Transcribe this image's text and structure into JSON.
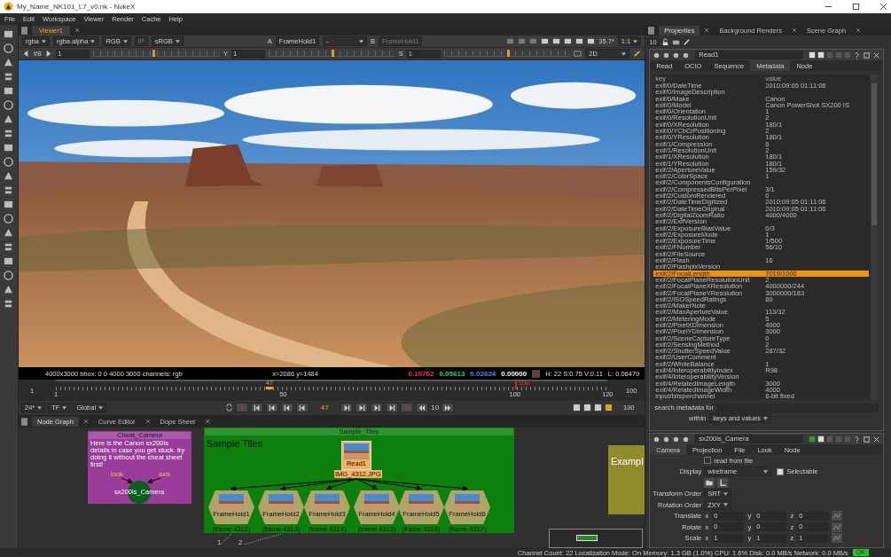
{
  "window": {
    "title": "My_Name_NK101_L7_v0.nk - NukeX"
  },
  "menu": [
    "File",
    "Edit",
    "Workspace",
    "Viewer",
    "Render",
    "Cache",
    "Help"
  ],
  "viewer": {
    "tab": "Viewer1",
    "toolbar1": {
      "channels": "rgba",
      "alpha": "rgba.alpha",
      "display": "RGB",
      "ip": "IP",
      "lut": "sRGB",
      "a_label": "A",
      "a_input": "FrameHold1",
      "op": "-",
      "b_label": "B",
      "b_input": "FrameHold1",
      "zoom": "35.7*",
      "ratio": "1:1"
    },
    "toolbar2": {
      "fstop": "f/8",
      "gain": "1",
      "gain_slider": {
        "level": 0.47
      },
      "gamma_label": "Y",
      "gamma": "1",
      "gamma_slider": {
        "level": 0.5
      },
      "sat_label": "S",
      "sat": "1",
      "sat_slider": {
        "level": 0.5
      },
      "mode": "2D"
    },
    "info": {
      "format": "4000x3000  bbox: 0 0 4000 3000 channels: rgb",
      "coords": "x=2086 y=1484",
      "samples": [
        {
          "value": "0.10702",
          "color": "#ff3030"
        },
        {
          "value": "0.05613",
          "color": "#30d060"
        },
        {
          "value": "0.02624",
          "color": "#4a8cff"
        },
        {
          "value": "0.00000",
          "color": "#ffffff"
        }
      ],
      "swatch": {
        "color": "#5e4632"
      },
      "hsv": "H: 22 S:0.75 V:0.11",
      "luma": "L: 0.06479"
    }
  },
  "timeline": {
    "start": "1",
    "end": "100",
    "current": "47",
    "playhead": {
      "level": 0.387
    },
    "out_mark": "100",
    "out_point": {
      "level": 0.832
    },
    "ticks": [
      {
        "label": "1",
        "level": 0
      },
      {
        "label": "50",
        "level": 0.412
      },
      {
        "label": "100",
        "level": 0.832
      },
      {
        "label": "120",
        "level": 1
      }
    ]
  },
  "playback": {
    "fps": "24*",
    "tf": "TF",
    "scope": "Global",
    "in": "I",
    "frame": "47",
    "out": "O",
    "step": "10",
    "last": "100"
  },
  "node_graph": {
    "tabs": [
      {
        "label": "Node Graph",
        "selected": true
      },
      {
        "label": "Curve Editor",
        "selected": false
      },
      {
        "label": "Dope Sheet",
        "selected": false
      }
    ],
    "backdrops": [
      {
        "title": "Cheat_Camera",
        "color": "#9a3c9a",
        "note": "Here is the Canon sx200is details in case you get stuck. try doing it without the cheat sheet first!"
      },
      {
        "title": "Sample_Tiles",
        "color": "#0d7f0d",
        "note": "Sample Tiles"
      },
      {
        "title": "Exampl",
        "color": "#8e8b2c"
      }
    ],
    "read_node": {
      "name": "Read1",
      "file": "IMG_4312.JPG"
    },
    "framehold_nodes": [
      {
        "name": "FrameHold1",
        "frame": "(frame 4312)"
      },
      {
        "name": "FrameHold2",
        "frame": "(frame 4313)"
      },
      {
        "name": "FrameHold3",
        "frame": "(frame 4314)"
      },
      {
        "name": "FrameHold4",
        "frame": "(frame 4315)"
      },
      {
        "name": "FrameHold5",
        "frame": "(frame 4316)"
      },
      {
        "name": "FrameHold6",
        "frame": "(frame 4317)"
      }
    ],
    "camera_node": {
      "name": "sx200is_Camera",
      "inputs": [
        "look",
        "axis"
      ]
    },
    "pipe_labels": [
      "1",
      "2"
    ]
  },
  "status_bar": "Channel Count: 22  Localization Mode: On  Memory: 1.3 GB (1.0%)  CPU: 1.6%  Disk: 0.0 MB/s  Network: 0.0 MB/s",
  "status_ok": "OK",
  "properties": {
    "tabs": [
      {
        "label": "Properties",
        "selected": true
      },
      {
        "label": "Background Renders",
        "selected": false
      },
      {
        "label": "Scene Graph",
        "selected": false
      }
    ],
    "max_panels": "10",
    "read_panel": {
      "name": "Read1",
      "tabs": [
        {
          "label": "Read",
          "selected": false
        },
        {
          "label": "OCIO",
          "selected": false
        },
        {
          "label": "Sequence",
          "selected": false
        },
        {
          "label": "Metadata",
          "selected": true
        },
        {
          "label": "Node",
          "selected": false
        }
      ],
      "columns": [
        "key",
        "value"
      ],
      "rows": [
        {
          "key": "exif/0/DateTime",
          "value": "2010:09:05 01:11:06",
          "selected": false
        },
        {
          "key": "exif/0/ImageDescription",
          "selected": false
        },
        {
          "key": "exif/0/Make",
          "value": "Canon",
          "selected": false
        },
        {
          "key": "exif/0/Model",
          "value": "Canon PowerShot SX200 IS",
          "selected": false
        },
        {
          "key": "exif/0/Orientation",
          "value": "1",
          "selected": false
        },
        {
          "key": "exif/0/ResolutionUnit",
          "value": "2",
          "selected": false
        },
        {
          "key": "exif/0/XResolution",
          "value": "180/1",
          "selected": false
        },
        {
          "key": "exif/0/YCbCrPositioning",
          "value": "2",
          "selected": false
        },
        {
          "key": "exif/0/YResolution",
          "value": "180/1",
          "selected": false
        },
        {
          "key": "exif/1/Compression",
          "value": "6",
          "selected": false
        },
        {
          "key": "exif/1/ResolutionUnit",
          "value": "2",
          "selected": false
        },
        {
          "key": "exif/1/XResolution",
          "value": "180/1",
          "selected": false
        },
        {
          "key": "exif/1/YResolution",
          "value": "180/1",
          "selected": false
        },
        {
          "key": "exif/2/ApertureValue",
          "value": "159/32",
          "selected": false
        },
        {
          "key": "exif/2/ColorSpace",
          "value": "1",
          "selected": false
        },
        {
          "key": "exif/2/ComponentsConfiguration",
          "selected": false
        },
        {
          "key": "exif/2/CompressedBitsPerPixel",
          "value": "3/1",
          "selected": false
        },
        {
          "key": "exif/2/CustomRendered",
          "value": "0",
          "selected": false
        },
        {
          "key": "exif/2/DateTimeDigitized",
          "value": "2010:09:05 01:11:06",
          "selected": false
        },
        {
          "key": "exif/2/DateTimeOriginal",
          "value": "2010:09:05 01:11:06",
          "selected": false
        },
        {
          "key": "exif/2/DigitalZoomRatio",
          "value": "4000/4000",
          "selected": false
        },
        {
          "key": "exif/2/ExifVersion",
          "selected": false
        },
        {
          "key": "exif/2/ExposureBiasValue",
          "value": "0/3",
          "selected": false
        },
        {
          "key": "exif/2/ExposureMode",
          "value": "1",
          "selected": false
        },
        {
          "key": "exif/2/ExposureTime",
          "value": "1/500",
          "selected": false
        },
        {
          "key": "exif/2/FNumber",
          "value": "56/10",
          "selected": false
        },
        {
          "key": "exif/2/FileSource",
          "selected": false
        },
        {
          "key": "exif/2/Flash",
          "value": "16",
          "selected": false
        },
        {
          "key": "exif/2/FlashpixVersion",
          "selected": false
        },
        {
          "key": "exif/2/FocalLength",
          "value": "7019/1000",
          "selected": true
        },
        {
          "key": "exif/2/FocalPlaneResolutionUnit",
          "value": "2",
          "selected": false
        },
        {
          "key": "exif/2/FocalPlaneXResolution",
          "value": "4000000/244",
          "selected": false
        },
        {
          "key": "exif/2/FocalPlaneYResolution",
          "value": "3000000/183",
          "selected": false
        },
        {
          "key": "exif/2/ISOSpeedRatings",
          "value": "80",
          "selected": false
        },
        {
          "key": "exif/2/MakerNote",
          "selected": false
        },
        {
          "key": "exif/2/MaxApertureValue",
          "value": "113/32",
          "selected": false
        },
        {
          "key": "exif/2/MeteringMode",
          "value": "5",
          "selected": false
        },
        {
          "key": "exif/2/PixelXDimension",
          "value": "4000",
          "selected": false
        },
        {
          "key": "exif/2/PixelYDimension",
          "value": "3000",
          "selected": false
        },
        {
          "key": "exif/2/SceneCaptureType",
          "value": "0",
          "selected": false
        },
        {
          "key": "exif/2/SensingMethod",
          "value": "2",
          "selected": false
        },
        {
          "key": "exif/2/ShutterSpeedValue",
          "value": "287/32",
          "selected": false
        },
        {
          "key": "exif/2/UserComment",
          "selected": false
        },
        {
          "key": "exif/2/WhiteBalance",
          "value": "1",
          "selected": false
        },
        {
          "key": "exif/4/InteroperabilityIndex",
          "value": "R98",
          "selected": false
        },
        {
          "key": "exif/4/InteroperabilityVersion",
          "selected": false
        },
        {
          "key": "exif/4/RelatedImageLength",
          "value": "3000",
          "selected": false
        },
        {
          "key": "exif/4/RelatedImageWidth",
          "value": "4000",
          "selected": false
        },
        {
          "key": "input/bitsperchannel",
          "value": "8-bit fixed",
          "selected": false
        }
      ],
      "search_label": "search metadata for",
      "within_label": "within",
      "within_value": "keys and values"
    },
    "camera_panel": {
      "name": "sx200is_Camera",
      "tabs": [
        {
          "label": "Camera",
          "selected": true
        },
        {
          "label": "Projection",
          "selected": false
        },
        {
          "label": "File",
          "selected": false
        },
        {
          "label": "Look",
          "selected": false
        },
        {
          "label": "Node",
          "selected": false
        }
      ],
      "read_from_file": {
        "label": "read from file",
        "checked": false
      },
      "display_label": "Display",
      "display": "wireframe",
      "selectable": {
        "label": "Selectable",
        "checked": true
      },
      "transform_order_label": "Transform Order",
      "transform_order": "SRT",
      "rotation_order_label": "Rotation Order",
      "rotation_order": "ZXY",
      "vectors": [
        {
          "label": "Translate",
          "axes": [
            {
              "axis": "x",
              "value": "0"
            },
            {
              "axis": "y",
              "value": "0"
            },
            {
              "axis": "z",
              "value": "0"
            }
          ]
        },
        {
          "label": "Rotate",
          "axes": [
            {
              "axis": "x",
              "value": "0"
            },
            {
              "axis": "y",
              "value": "0"
            },
            {
              "axis": "z",
              "value": "0"
            }
          ]
        },
        {
          "label": "Scale",
          "axes": [
            {
              "axis": "x",
              "value": "1"
            },
            {
              "axis": "y",
              "value": "1"
            },
            {
              "axis": "z",
              "value": "1"
            }
          ]
        }
      ]
    }
  }
}
